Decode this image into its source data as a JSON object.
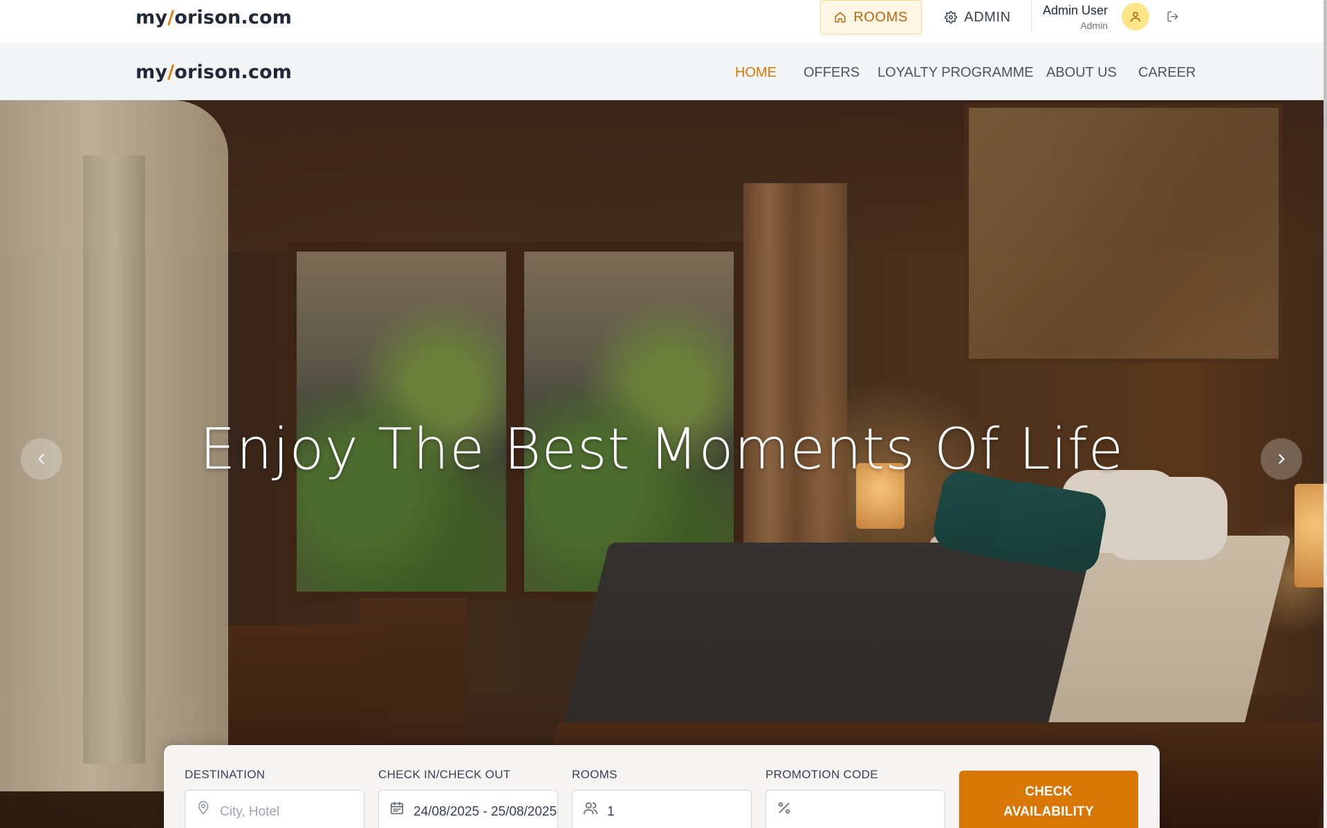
{
  "topbar": {
    "logo_prefix": "my",
    "logo_slash": "/",
    "logo_suffix": "orison.com",
    "rooms_label": "ROOMS",
    "admin_label": "ADMIN",
    "user_name": "Admin User",
    "user_role": "Admin"
  },
  "nav": {
    "logo_prefix": "my",
    "logo_slash": "/",
    "logo_suffix": "orison.com",
    "items": [
      {
        "label": "HOME",
        "active": true
      },
      {
        "label": "OFFERS",
        "active": false
      },
      {
        "label": "LOYALTY PROGRAMME",
        "active": false
      },
      {
        "label": "ABOUT US",
        "active": false
      },
      {
        "label": "CAREER",
        "active": false
      }
    ]
  },
  "hero": {
    "title": "Enjoy The Best Moments Of Life"
  },
  "booking": {
    "destination": {
      "label": "DESTINATION",
      "placeholder": "City, Hotel",
      "icon": "map-pin-icon"
    },
    "dates": {
      "label": "CHECK IN/CHECK OUT",
      "value": "24/08/2025 - 25/08/2025",
      "icon": "calendar-icon"
    },
    "rooms": {
      "label": "ROOMS",
      "value": "1",
      "icon": "users-icon"
    },
    "promo": {
      "label": "PROMOTION CODE",
      "value": "",
      "icon": "percent-icon"
    },
    "submit_label": "CHECK AVAILABILITY"
  },
  "colors": {
    "accent": "#d97706",
    "accent_light": "#fef6e4",
    "text_dark": "#1f2937"
  }
}
